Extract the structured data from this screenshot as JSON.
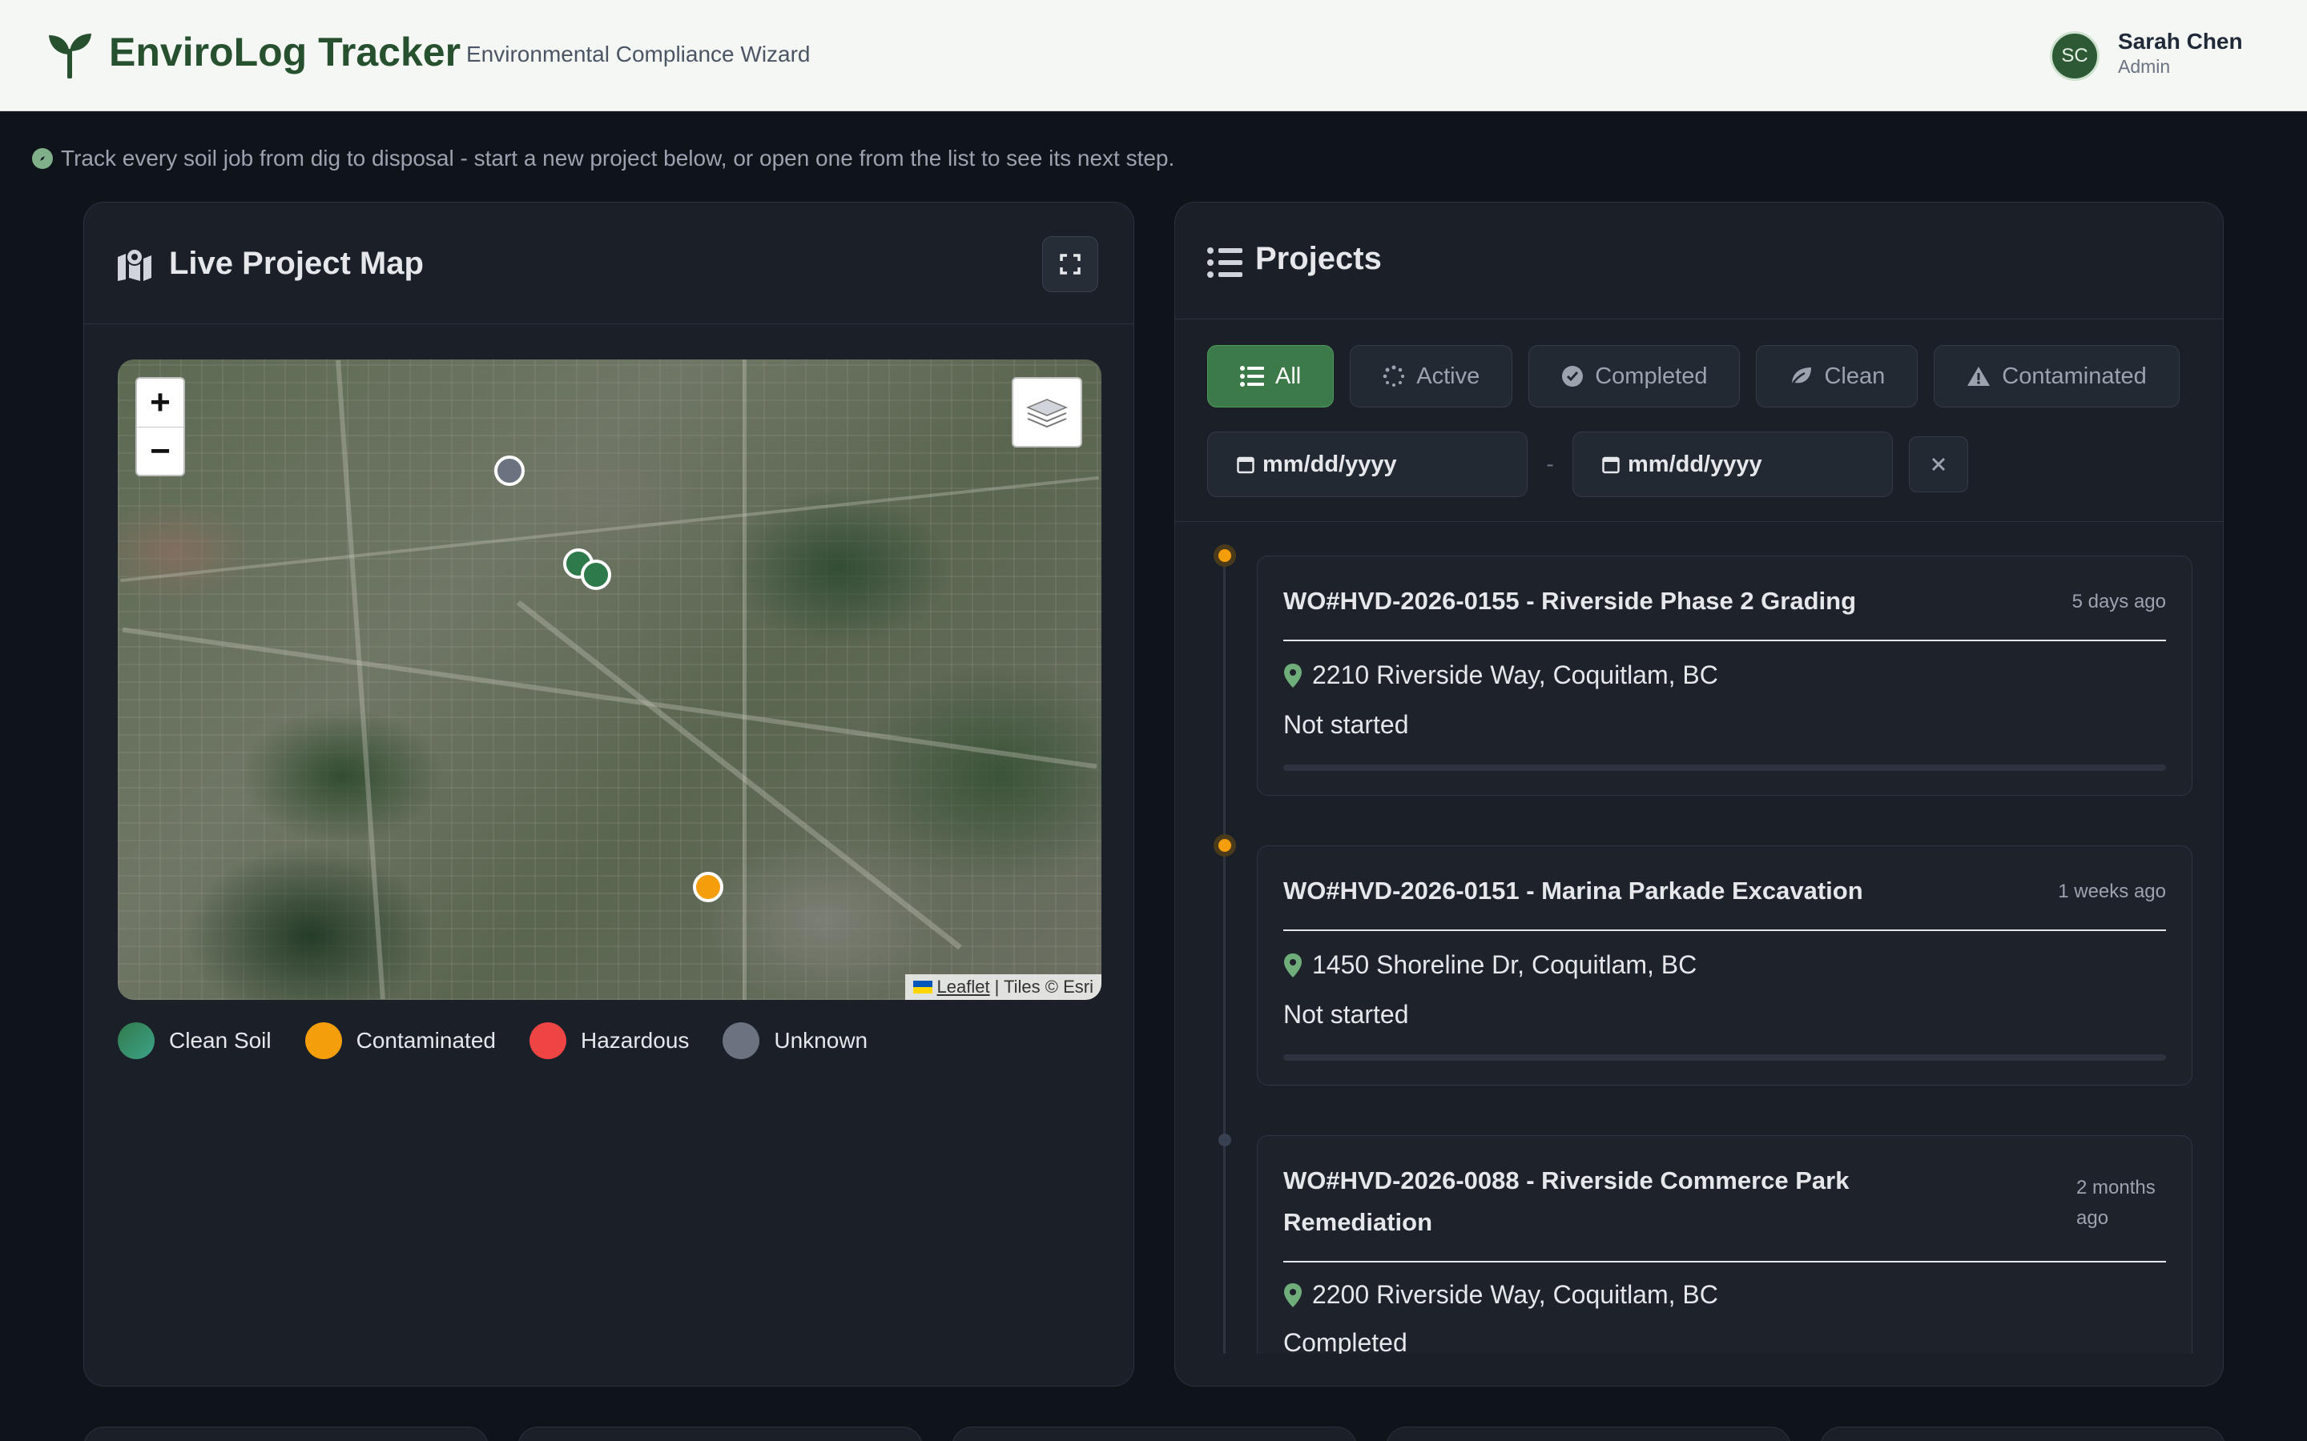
{
  "header": {
    "app_title": "EnviroLog Tracker",
    "app_subtitle": "Environmental Compliance Wizard",
    "user": {
      "initials": "SC",
      "name": "Sarah Chen",
      "role": "Admin"
    }
  },
  "info_line": "Track every soil job from dig to disposal - start a new project below, or open one from the list to see its next step.",
  "map_panel": {
    "title": "Live Project Map",
    "zoom_in": "+",
    "zoom_out": "−",
    "attribution": {
      "link": "Leaflet",
      "rest": "| Tiles © Esri"
    },
    "legend": [
      {
        "label": "Clean Soil",
        "color": "#3d8f6a"
      },
      {
        "label": "Contaminated",
        "color": "#f59e0b"
      },
      {
        "label": "Hazardous",
        "color": "#ef4444"
      },
      {
        "label": "Unknown",
        "color": "#6b7280"
      }
    ],
    "marker_colors": {
      "clean": "#2f7a4a",
      "contaminated": "#f59e0b",
      "unknown": "#6b7280"
    }
  },
  "projects_panel": {
    "title": "Projects",
    "filters": [
      {
        "label": "All",
        "icon": "list-icon",
        "active": true
      },
      {
        "label": "Active",
        "icon": "spinner-icon",
        "active": false
      },
      {
        "label": "Completed",
        "icon": "check-circle-icon",
        "active": false
      },
      {
        "label": "Clean",
        "icon": "leaf-icon",
        "active": false
      },
      {
        "label": "Contaminated",
        "icon": "warning-icon",
        "active": false
      }
    ],
    "date_from_placeholder": "mm/dd/yyyy",
    "date_to_placeholder": "mm/dd/yyyy",
    "date_separator": "-",
    "projects": [
      {
        "title": "WO#HVD-2026-0155 - Riverside Phase 2 Grading",
        "time": "5 days ago",
        "address": "2210 Riverside Way, Coquitlam, BC",
        "status": "Not started"
      },
      {
        "title": "WO#HVD-2026-0151 - Marina Parkade Excavation",
        "time": "1 weeks ago",
        "address": "1450 Shoreline Dr, Coquitlam, BC",
        "status": "Not started"
      },
      {
        "title": "WO#HVD-2026-0088 - Riverside Commerce Park Remediation",
        "time": "2 months ago",
        "address": "2200 Riverside Way, Coquitlam, BC",
        "status": "Completed"
      }
    ]
  }
}
